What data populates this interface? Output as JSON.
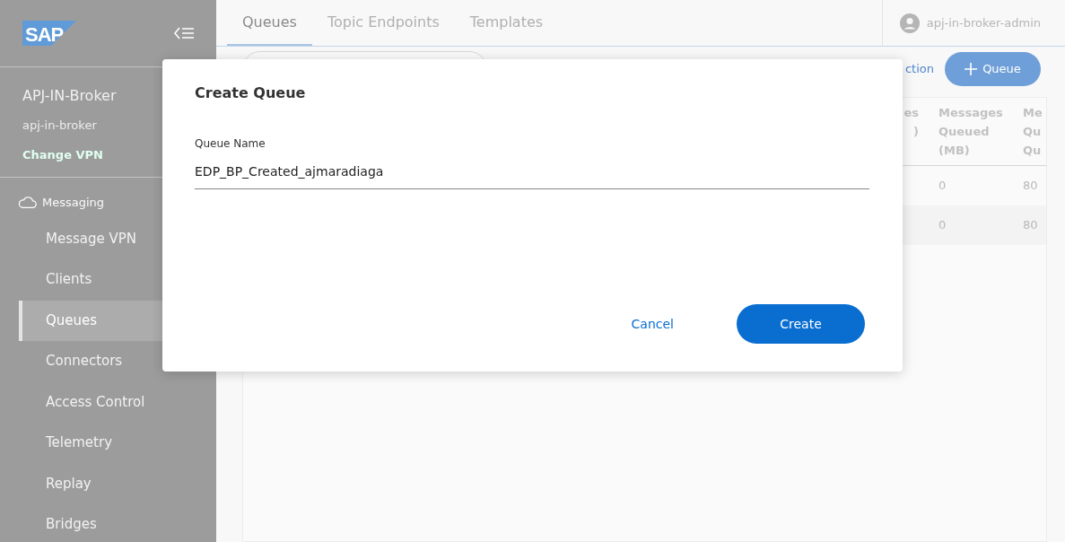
{
  "sidebar": {
    "logo": "SAP",
    "broker_name": "APJ-IN-Broker",
    "vpn_name": "apj-in-broker",
    "change_vpn": "Change VPN",
    "section": "Messaging",
    "items": [
      {
        "label": "Message VPN",
        "selected": false
      },
      {
        "label": "Clients",
        "selected": false
      },
      {
        "label": "Queues",
        "selected": true
      },
      {
        "label": "Connectors",
        "selected": false
      },
      {
        "label": "Access Control",
        "selected": false
      },
      {
        "label": "Telemetry",
        "selected": false
      },
      {
        "label": "Replay",
        "selected": false
      },
      {
        "label": "Bridges",
        "selected": false
      }
    ]
  },
  "tabs": [
    {
      "label": "Queues",
      "selected": true
    },
    {
      "label": "Topic Endpoints",
      "selected": false
    },
    {
      "label": "Templates",
      "selected": false
    }
  ],
  "user": "apj-in-broker-admin",
  "toolbar": {
    "link": "ction",
    "add_button": "Queue"
  },
  "table": {
    "columns": [
      "es\n)",
      "Messages\nQueued\n(MB)",
      "Me\nQu\nQu"
    ],
    "rows": [
      {
        "column_2": "0",
        "column_3": "80"
      },
      {
        "column_2": "0",
        "column_3": "80"
      }
    ]
  },
  "dialog": {
    "title": "Create Queue",
    "field_label": "Queue Name",
    "field_value": "EDP_BP_Created_ajmaradiaga",
    "buttons": [
      {
        "label": "Cancel",
        "kind": "link"
      },
      {
        "label": "Create",
        "kind": "primary"
      }
    ]
  }
}
